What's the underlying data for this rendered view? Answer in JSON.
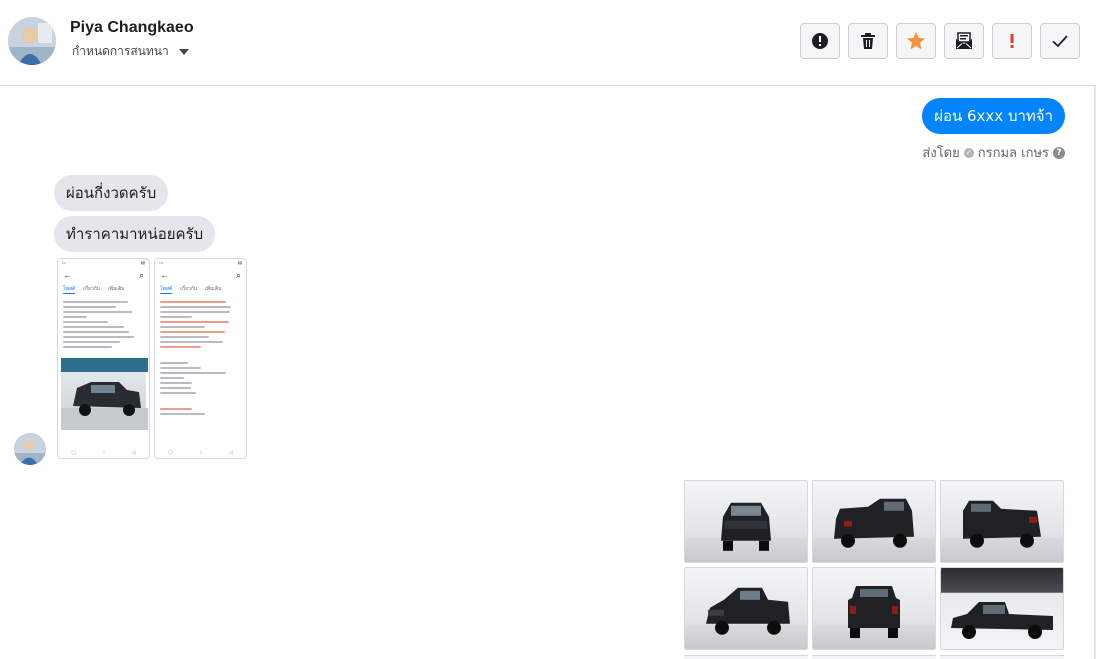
{
  "header": {
    "contact_name": "Piya Changkaeo",
    "assign_label": "กำหนดการสนทนา",
    "toolbar": [
      {
        "name": "spam",
        "icon": "alert-circle-icon"
      },
      {
        "name": "delete",
        "icon": "trash-icon"
      },
      {
        "name": "star",
        "icon": "star-icon",
        "color": "#f7923b"
      },
      {
        "name": "mark-unread",
        "icon": "envelope-icon"
      },
      {
        "name": "important",
        "icon": "exclamation-icon",
        "color": "#e0422e"
      },
      {
        "name": "done",
        "icon": "check-icon"
      }
    ]
  },
  "messages": {
    "outgoing": {
      "text": "ผ่อน 6xxx บาทจ้า",
      "sent_by_label": "ส่งโดย",
      "sent_by_name": "กรกมล เกษร",
      "color": "#0084ff"
    },
    "incoming": [
      {
        "text": "ผ่อนกี่งวดครับ"
      },
      {
        "text": "ทำราคามาหน่อยครับ"
      }
    ],
    "screenshots": [
      {
        "name": "screenshot-1",
        "tab_active": "โพสต์",
        "tabs": [
          "โพสต์",
          "เกี่ยวกับ",
          "เพิ่มเติม"
        ]
      },
      {
        "name": "screenshot-2",
        "tab_active": "โพสต์",
        "tabs": [
          "โพสต์",
          "เกี่ยวกับ",
          "เพิ่มเติม"
        ]
      }
    ],
    "photos": [
      {
        "name": "truck-front"
      },
      {
        "name": "truck-rear-left"
      },
      {
        "name": "truck-rear-right"
      },
      {
        "name": "truck-front-left"
      },
      {
        "name": "truck-rear"
      },
      {
        "name": "truck-side"
      }
    ]
  }
}
